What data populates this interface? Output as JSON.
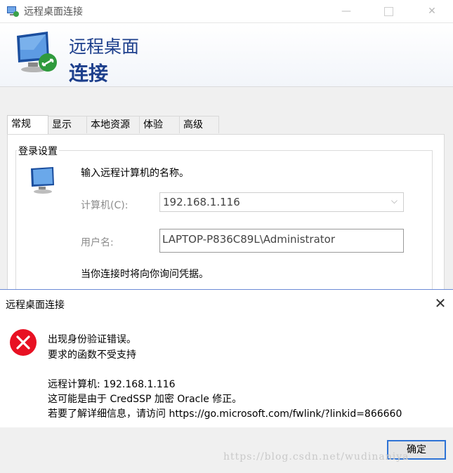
{
  "window": {
    "title": "远程桌面连接",
    "min_glyph": "—",
    "close_glyph": "✕"
  },
  "banner": {
    "line1": "远程桌面",
    "line2": "连接"
  },
  "tabs": [
    {
      "label": "常规",
      "active": true
    },
    {
      "label": "显示",
      "active": false
    },
    {
      "label": "本地资源",
      "active": false
    },
    {
      "label": "体验",
      "active": false
    },
    {
      "label": "高级",
      "active": false
    }
  ],
  "logon": {
    "group_title": "登录设置",
    "prompt": "输入远程计算机的名称。",
    "computer_label": "计算机(C):",
    "computer_value": "192.168.1.116",
    "username_label": "用户名:",
    "username_value": "LAPTOP-P836C89L\\Administrator",
    "credentials_note": "当你连接时将向你询问凭据。"
  },
  "error_dialog": {
    "title": "远程桌面连接",
    "close_glyph": "✕",
    "line1": "出现身份验证错误。",
    "line2": "要求的函数不受支持",
    "line3": "远程计算机: 192.168.1.116",
    "line4": "这可能是由于 CredSSP 加密 Oracle 修正。",
    "line5": "若要了解详细信息，请访问 https://go.microsoft.com/fwlink/?linkid=866660",
    "ok_label": "确定",
    "icon": "error-x-icon"
  },
  "watermark": "https://blog.csdn.net/wudinaniya",
  "colors": {
    "banner_text": "#1d3f8c",
    "error_red": "#e81123",
    "ok_border": "#2e73d5"
  }
}
